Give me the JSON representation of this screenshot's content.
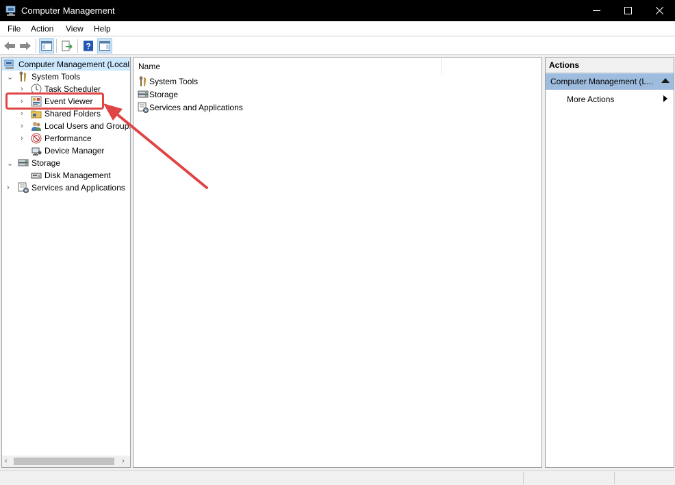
{
  "window": {
    "title": "Computer Management",
    "icon": "computer-management-icon",
    "controls": [
      "minimize-icon",
      "maximize-icon",
      "close-icon"
    ]
  },
  "menu": [
    "File",
    "Action",
    "View",
    "Help"
  ],
  "toolbar": [
    "back-arrow-icon",
    "forward-arrow-icon",
    "show-hide-console-tree-icon",
    "export-list-icon",
    "help-icon",
    "show-hide-action-pane-icon"
  ],
  "tree": {
    "root": "Computer Management (Local",
    "items": [
      {
        "label": "System Tools",
        "icon": "tools-icon",
        "expanded": true
      },
      {
        "label": "Task Scheduler",
        "icon": "clock-icon"
      },
      {
        "label": "Event Viewer",
        "icon": "event-viewer-icon",
        "highlighted": true
      },
      {
        "label": "Shared Folders",
        "icon": "shared-folder-icon"
      },
      {
        "label": "Local Users and Groups",
        "icon": "users-icon"
      },
      {
        "label": "Performance",
        "icon": "performance-icon"
      },
      {
        "label": "Device Manager",
        "icon": "device-manager-icon"
      },
      {
        "label": "Storage",
        "icon": "storage-icon",
        "expanded": true
      },
      {
        "label": "Disk Management",
        "icon": "disk-icon"
      },
      {
        "label": "Services and Applications",
        "icon": "services-icon"
      }
    ]
  },
  "list": {
    "column_name": "Name",
    "rows": [
      "System Tools",
      "Storage",
      "Services and Applications"
    ]
  },
  "actions": {
    "title": "Actions",
    "group": "Computer Management (L...",
    "more": "More Actions"
  },
  "colors": {
    "annotation": "#e04545",
    "selection": "#cce8ff",
    "actions_group_bg": "#9ebcde"
  }
}
